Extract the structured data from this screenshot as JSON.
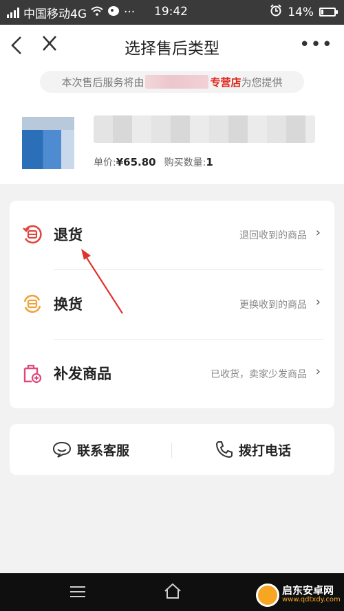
{
  "status_bar": {
    "carrier": "中国移动4G",
    "time": "19:42",
    "battery": "14%",
    "more": "···"
  },
  "nav": {
    "title": "选择售后类型",
    "back_icon": "chevron-left-icon",
    "close_icon": "close-icon",
    "more": "•••"
  },
  "notice": {
    "prefix": "本次售后服务将由",
    "shop": "专营店",
    "suffix": "为您提供"
  },
  "product": {
    "price_label": "单价:",
    "price": "¥65.80",
    "qty_label": "购买数量:",
    "qty": "1"
  },
  "options": [
    {
      "label": "退货",
      "desc": "退回收到的商品",
      "color": "#e0463e",
      "icon": "return-goods-icon"
    },
    {
      "label": "换货",
      "desc": "更换收到的商品",
      "color": "#f0a23a",
      "icon": "exchange-goods-icon"
    },
    {
      "label": "补发商品",
      "desc": "已收货，卖家少发商品",
      "color": "#e0477c",
      "icon": "reissue-goods-icon"
    }
  ],
  "chevron": "›",
  "contact": {
    "service": "联系客服",
    "call": "拨打电话"
  },
  "watermark": {
    "name": "启东安卓网",
    "site": "www.qdtxdy.com"
  },
  "colors": {
    "accent": "#e1251b",
    "annotation_arrow": "#e0332b"
  }
}
